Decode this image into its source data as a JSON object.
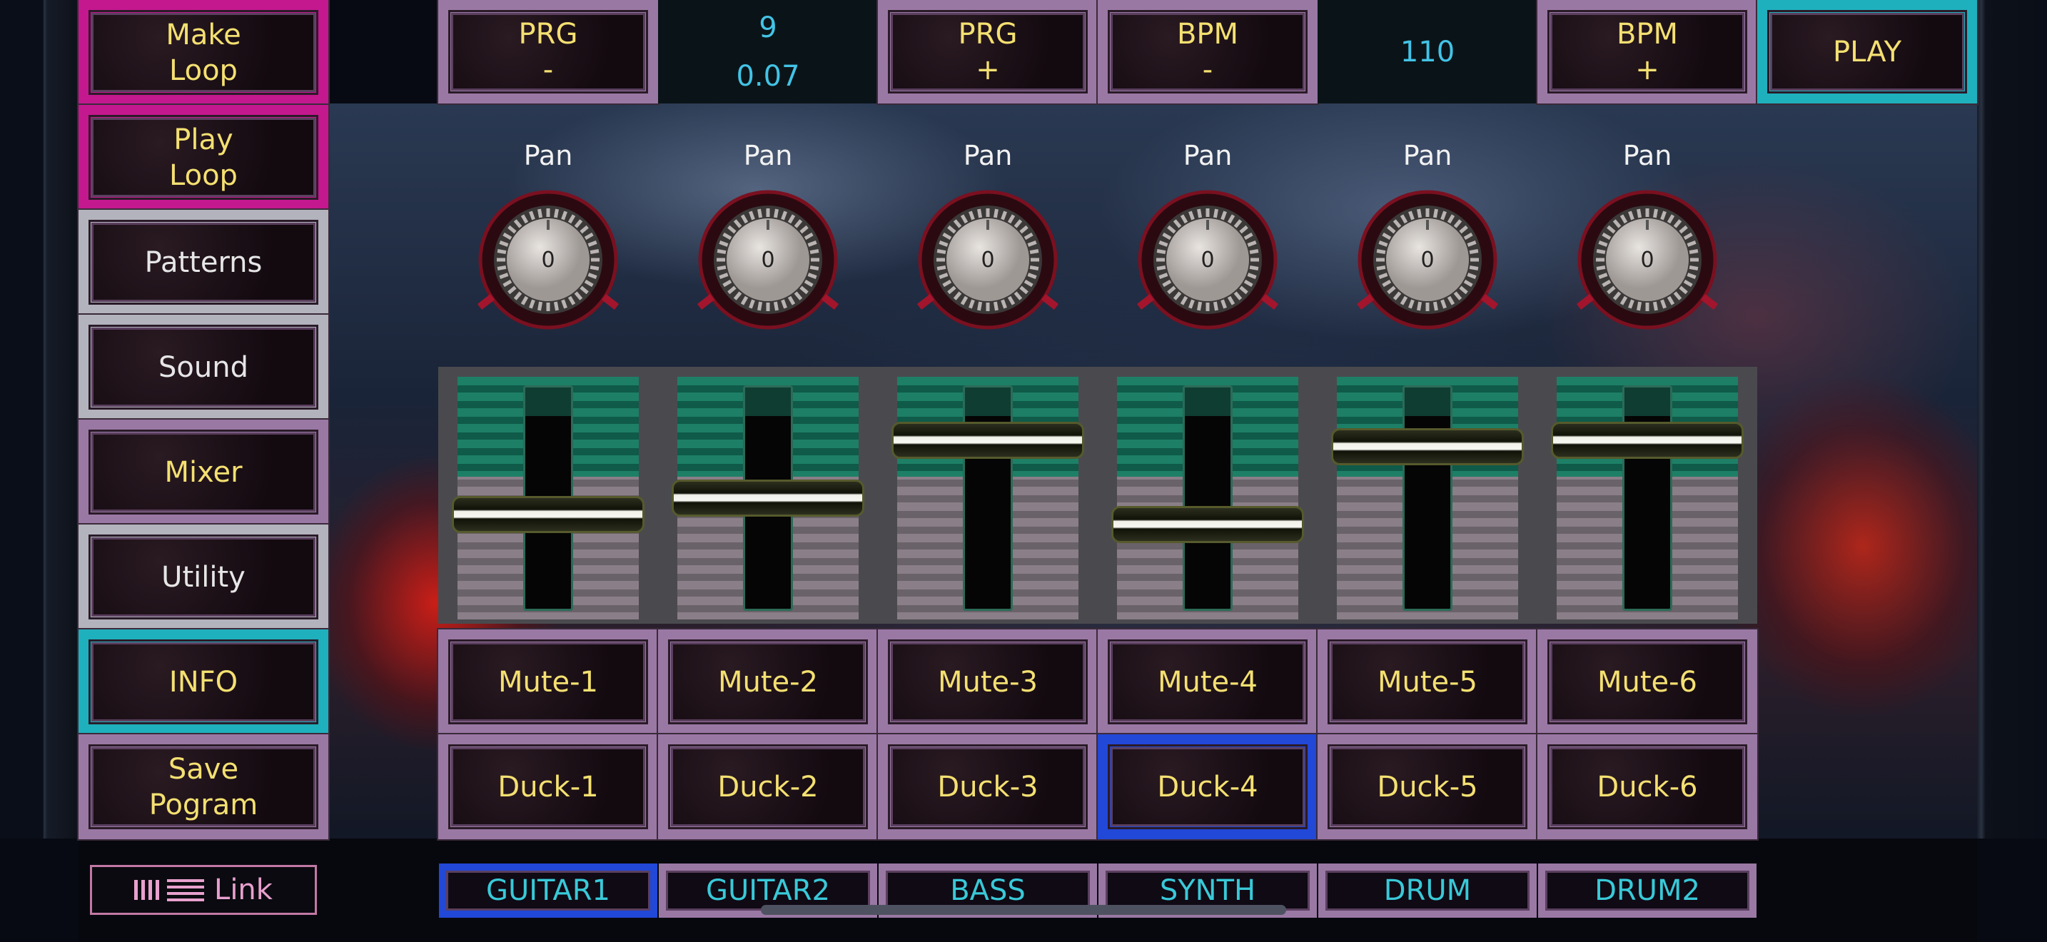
{
  "sidebar": {
    "items": [
      {
        "label": "Make\nLoop",
        "frame": "magenta"
      },
      {
        "label": "Play\nLoop",
        "frame": "magenta"
      },
      {
        "label": "Patterns",
        "frame": "gray"
      },
      {
        "label": "Sound",
        "frame": "gray"
      },
      {
        "label": "Mixer",
        "frame": "purple"
      },
      {
        "label": "Utility",
        "frame": "gray"
      },
      {
        "label": "INFO",
        "frame": "cyan"
      },
      {
        "label": "Save\nPogram",
        "frame": "purple"
      }
    ]
  },
  "toolbar": {
    "prg_minus": "PRG\n-",
    "prg_value": "9",
    "prg_sub_value": "0.07",
    "prg_plus": "PRG\n+",
    "bpm_minus": "BPM\n-",
    "bpm_value": "110",
    "bpm_plus": "BPM\n+",
    "play": "PLAY"
  },
  "channels": [
    {
      "pan_label": "Pan",
      "pan_value": "0",
      "fader_level": 0.42,
      "mute": "Mute-1",
      "duck": "Duck-1",
      "duck_active": false
    },
    {
      "pan_label": "Pan",
      "pan_value": "0",
      "fader_level": 0.5,
      "mute": "Mute-2",
      "duck": "Duck-2",
      "duck_active": false
    },
    {
      "pan_label": "Pan",
      "pan_value": "0",
      "fader_level": 0.78,
      "mute": "Mute-3",
      "duck": "Duck-3",
      "duck_active": false
    },
    {
      "pan_label": "Pan",
      "pan_value": "0",
      "fader_level": 0.37,
      "mute": "Mute-4",
      "duck": "Duck-4",
      "duck_active": true
    },
    {
      "pan_label": "Pan",
      "pan_value": "0",
      "fader_level": 0.75,
      "mute": "Mute-5",
      "duck": "Duck-5",
      "duck_active": false
    },
    {
      "pan_label": "Pan",
      "pan_value": "0",
      "fader_level": 0.78,
      "mute": "Mute-6",
      "duck": "Duck-6",
      "duck_active": false
    }
  ],
  "instruments": [
    {
      "label": "GUITAR1",
      "active": true
    },
    {
      "label": "GUITAR2",
      "active": false
    },
    {
      "label": "BASS",
      "active": false
    },
    {
      "label": "SYNTH",
      "active": false
    },
    {
      "label": "DRUM",
      "active": false
    },
    {
      "label": "DRUM2",
      "active": false
    }
  ],
  "link": {
    "label": "Link"
  },
  "colors": {
    "accent_yellow": "#f4e071",
    "accent_cyan": "#39c9d8",
    "display_blue": "#43c3e6",
    "frame_purple": "#9a78a4",
    "frame_magenta": "#c4188f",
    "frame_cyan": "#1fb0bd",
    "active_blue": "#2248d8",
    "fader_green": "#1d7f66"
  }
}
